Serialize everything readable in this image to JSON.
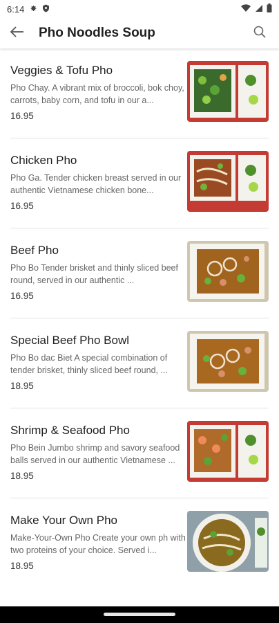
{
  "status": {
    "time": "6:14"
  },
  "header": {
    "title": "Pho Noodles Soup"
  },
  "items": [
    {
      "name": "Veggies & Tofu Pho",
      "description": "Pho Chay. A vibrant mix of broccoli, bok choy, carrots, baby corn, and tofu in our a...",
      "price": "16.95"
    },
    {
      "name": "Chicken Pho",
      "description": "Pho Ga.  Tender chicken breast served in our authentic Vietnamese chicken bone...",
      "price": "16.95"
    },
    {
      "name": "Beef Pho",
      "description": "Pho Bo Tender brisket and thinly sliced beef round, served in our authentic ...",
      "price": "16.95"
    },
    {
      "name": "Special Beef Pho Bowl",
      "description": "Pho Bo dac Biet A special combination of tender brisket, thinly sliced beef round, ...",
      "price": "18.95"
    },
    {
      "name": "Shrimp & Seafood Pho",
      "description": "Pho Bein Jumbo shrimp and savory seafood balls served in our authentic Vietnamese ...",
      "price": "18.95"
    },
    {
      "name": "Make Your Own Pho",
      "description": "Make-Your-Own Pho Create your own ph with two proteins of your choice. Served i...",
      "price": "18.95"
    }
  ]
}
